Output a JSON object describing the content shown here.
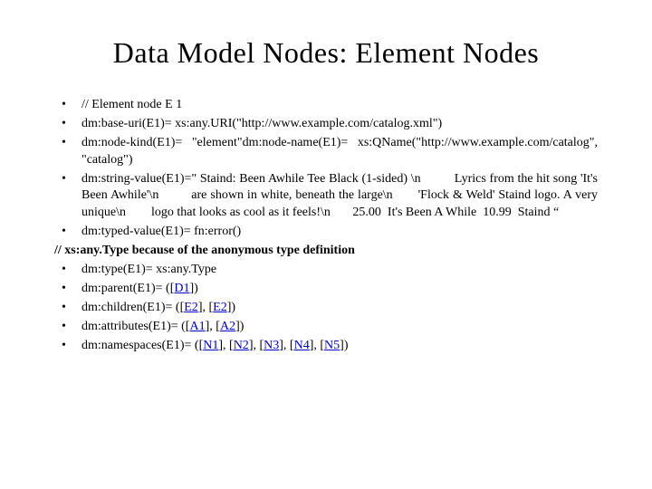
{
  "title": "Data Model Nodes: Element Nodes",
  "bullets": {
    "b1": "// Element node E 1",
    "b2": "dm:base-uri(E1)= xs:any.URI(\"http://www.example.com/catalog.xml\")",
    "b3": "dm:node-kind(E1)= \"element\"dm:node-name(E1)= xs:QName(\"http://www.example.com/catalog\", \"catalog\")",
    "b4": "dm:string-value(E1)=\" Staind: Been Awhile Tee Black (1-sided) \\n          Lyrics from the hit song 'It's Been Awhile'\\n         are shown in white, beneath the large\\n       'Flock & Weld' Staind logo. A very unique\\n        logo that looks as cool as it feels!\\n       25.00  It's Been A While  10.99  Staind “",
    "b5": "dm:typed-value(E1)= fn:error()",
    "note": "// xs:any.Type because of the anonymous type definition",
    "b6": "dm:type(E1)= xs:any.Type",
    "b7_pre": "dm:parent(E1)= ([",
    "b7_l1": "D1",
    "b7_post": "])",
    "b8_pre": "dm:children(E1)= ([",
    "b8_l1": "E2",
    "b8_mid": "], [",
    "b8_l2": "E2",
    "b8_post": "])",
    "b9_pre": "dm:attributes(E1)= ([",
    "b9_l1": "A1",
    "b9_mid": "], [",
    "b9_l2": "A2",
    "b9_post": "])",
    "b10_pre": "dm:namespaces(E1)= ([",
    "b10_l1": "N1",
    "b10_m1": "], [",
    "b10_l2": "N2",
    "b10_m2": "], [",
    "b10_l3": "N3",
    "b10_m3": "], [",
    "b10_l4": "N4",
    "b10_m4": "], [",
    "b10_l5": "N5",
    "b10_post": "])"
  }
}
